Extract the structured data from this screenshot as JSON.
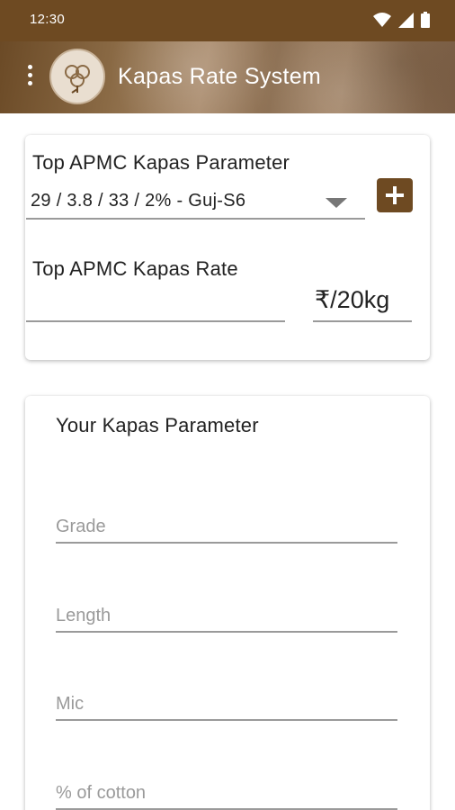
{
  "status_bar": {
    "time": "12:30",
    "icons": [
      "wifi-icon",
      "signal-icon",
      "battery-icon"
    ]
  },
  "app_bar": {
    "title": "Kapas Rate System",
    "menu_icon": "more-vert-icon",
    "logo_icon": "cotton-logo-icon"
  },
  "top_card": {
    "parameter_label": "Top APMC Kapas Parameter",
    "parameter_value": "29 / 3.8 / 33 / 2% - Guj-S6",
    "add_button_icon": "plus-icon",
    "rate_label": "Top APMC Kapas Rate",
    "rate_value": "",
    "unit_label": "₹/20kg"
  },
  "bottom_card": {
    "heading": "Your Kapas Parameter",
    "fields": [
      {
        "placeholder": "Grade",
        "value": ""
      },
      {
        "placeholder": "Length",
        "value": ""
      },
      {
        "placeholder": "Mic",
        "value": ""
      },
      {
        "placeholder": "% of cotton",
        "value": ""
      }
    ]
  },
  "colors": {
    "primary": "#6e4a22",
    "underline": "#9a9a9a",
    "placeholder": "#9a9a9a"
  }
}
